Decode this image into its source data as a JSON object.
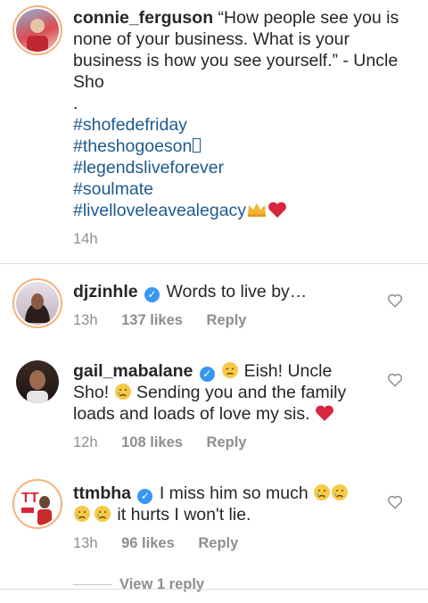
{
  "post": {
    "username": "connie_ferguson",
    "caption": "“How people see you is none of your business. What is your business is how you see yourself.” - Uncle Sho",
    "dot": ".",
    "hashtags": [
      "#shofedefriday",
      "#theshogoeson",
      "#legendsliveforever",
      "#soulmate",
      "#livelloveleavealegacy"
    ],
    "time": "14h"
  },
  "comments": [
    {
      "username": "djzinhle",
      "text": "Words to live by…",
      "time": "13h",
      "likes": "137 likes",
      "reply": "Reply"
    },
    {
      "username": "gail_mabalane",
      "text_a": "Eish! Uncle",
      "text_b": "Sho!",
      "text_c": "Sending you and the family loads and loads of love my sis.",
      "time": "12h",
      "likes": "108 likes",
      "reply": "Reply"
    },
    {
      "username": "ttmbha",
      "text_a": "I miss him so much",
      "text_b": "it hurts I won't lie.",
      "time": "13h",
      "likes": "96 likes",
      "reply": "Reply"
    }
  ],
  "view_reply": "View 1 reply",
  "icons": {
    "verified": "verified-badge-icon",
    "like": "heart-outline-icon"
  },
  "colors": {
    "hashtag": "#1d5a8f",
    "verified": "#3897f0",
    "ring": "#f5b27a"
  }
}
